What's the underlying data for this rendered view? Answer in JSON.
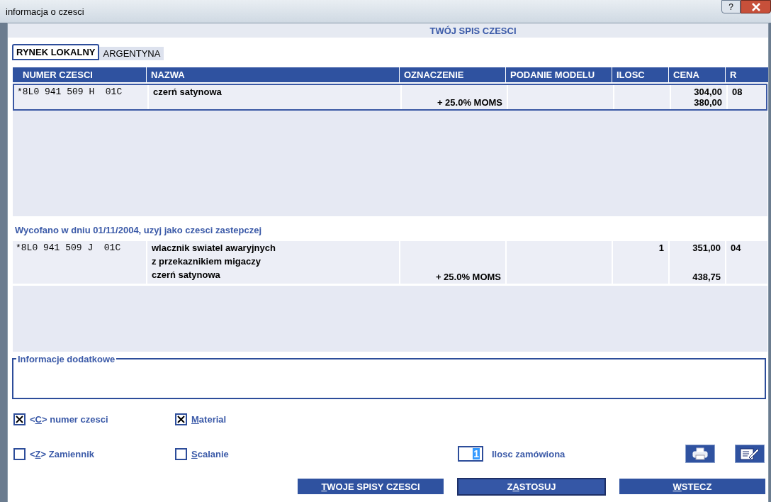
{
  "window": {
    "title": "informacja o czesci",
    "help": "?"
  },
  "header": "TWÓJ SPIS CZESCI",
  "tabs": [
    {
      "label": "RYNEK LOKALNY",
      "selected": true
    },
    {
      "label": "ARGENTYNA",
      "selected": false
    }
  ],
  "table": {
    "columns": [
      "NUMER CZESCI",
      "NAZWA",
      "OZNACZENIE",
      "PODANIE MODELU",
      "ILOSC",
      "CENA",
      "R"
    ],
    "rows": [
      {
        "part_number": "*8L0 941 509 H  01C",
        "name_lines": [
          "czerń satynowa"
        ],
        "tax": "+ 25.0% MOMS",
        "price": "304,00",
        "price_gross": "380,00",
        "r": "08",
        "selected": true
      }
    ]
  },
  "replacement": {
    "notice": "Wycofano w dniu 01/11/2004, uzyj jako czesci zastepczej",
    "rows": [
      {
        "part_number": "*8L0 941 509 J  01C",
        "name_lines": [
          "wlacznik swiatel awaryjnych",
          "z przekaznikiem migaczy",
          "czerń satynowa"
        ],
        "tax": "+ 25.0% MOMS",
        "quantity": "1",
        "price": "351,00",
        "price_gross": "438,75",
        "r": "04",
        "selected": false
      }
    ]
  },
  "additional_info": {
    "label": "Informacje dodatkowe"
  },
  "options": [
    {
      "before": "<",
      "key": "C",
      "after": "> numer czesci",
      "checked": true
    },
    {
      "key": "M",
      "after": "aterial",
      "checked": true
    },
    {
      "before": "<",
      "key": "Z",
      "after": "> Zamiennik",
      "checked": false
    },
    {
      "key": "S",
      "after": "calanie",
      "checked": false
    }
  ],
  "quantity": {
    "value": "1",
    "label": "Ilosc zamówiona"
  },
  "buttons": [
    {
      "key": "T",
      "after": "WOJE SPISY CZESCI",
      "default": false
    },
    {
      "before": "Z",
      "key": "A",
      "after": "STOSUJ",
      "default": true
    },
    {
      "key": "W",
      "after": "STECZ",
      "default": false
    }
  ]
}
